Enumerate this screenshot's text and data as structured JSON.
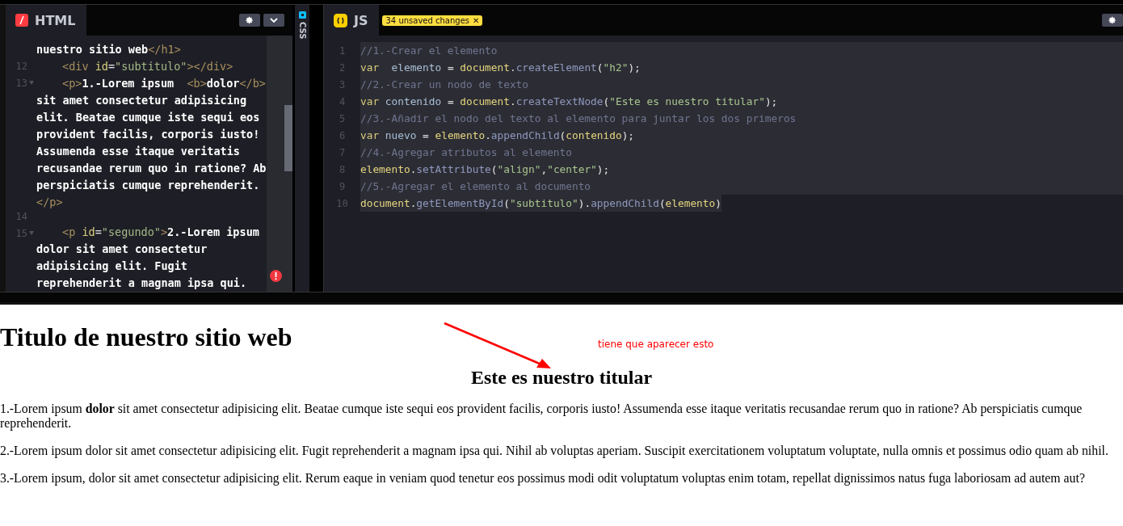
{
  "html_editor": {
    "title": "HTML",
    "lines": [
      {
        "tokens": [
          {
            "kind": "text",
            "text": "nuestro sitio web"
          },
          {
            "kind": "tag",
            "text": "</h1>"
          }
        ]
      },
      {
        "number": "12",
        "fold": false,
        "indented": true,
        "tokens": [
          {
            "kind": "tag",
            "text": "<div "
          },
          {
            "kind": "attr",
            "text": "id"
          },
          {
            "kind": "punct",
            "text": "="
          },
          {
            "kind": "string",
            "text": "\"subtitulo\""
          },
          {
            "kind": "tag",
            "text": "></div>"
          }
        ]
      },
      {
        "number": "13",
        "fold": true,
        "indented": true,
        "tokens": [
          {
            "kind": "tag",
            "text": "<p>"
          },
          {
            "kind": "text",
            "text": "1.-Lorem ipsum  "
          },
          {
            "kind": "tag",
            "text": "<b>"
          },
          {
            "kind": "text",
            "text": "dolor"
          },
          {
            "kind": "tag",
            "text": "</b>"
          }
        ]
      },
      {
        "tokens": [
          {
            "kind": "text",
            "text": "sit amet consectetur adipisicing"
          }
        ]
      },
      {
        "tokens": [
          {
            "kind": "text",
            "text": "elit. Beatae cumque iste sequi eos"
          }
        ]
      },
      {
        "tokens": [
          {
            "kind": "text",
            "text": "provident facilis, corporis iusto!"
          }
        ]
      },
      {
        "tokens": [
          {
            "kind": "text",
            "text": "Assumenda esse itaque veritatis"
          }
        ]
      },
      {
        "tokens": [
          {
            "kind": "text",
            "text": "recusandae rerum quo in ratione? Ab"
          }
        ]
      },
      {
        "tokens": [
          {
            "kind": "text",
            "text": "perspiciatis cumque reprehenderit."
          }
        ]
      },
      {
        "tokens": [
          {
            "kind": "tag",
            "text": "</p>"
          }
        ]
      },
      {
        "number": "14",
        "fold": false
      },
      {
        "number": "15",
        "fold": true,
        "indented": true,
        "tokens": [
          {
            "kind": "tag",
            "text": "<p "
          },
          {
            "kind": "attr",
            "text": "id"
          },
          {
            "kind": "punct",
            "text": "="
          },
          {
            "kind": "string",
            "text": "\"segundo\""
          },
          {
            "kind": "tag",
            "text": ">"
          },
          {
            "kind": "text",
            "text": "2.-Lorem ipsum"
          }
        ]
      },
      {
        "tokens": [
          {
            "kind": "text",
            "text": "dolor sit amet consectetur"
          }
        ]
      },
      {
        "tokens": [
          {
            "kind": "text",
            "text": "adipisicing elit. Fugit"
          }
        ]
      },
      {
        "tokens": [
          {
            "kind": "text",
            "text": "reprehenderit a magnam ipsa qui."
          }
        ]
      }
    ]
  },
  "css_editor": {
    "title": "CSS"
  },
  "js_editor": {
    "title": "JS",
    "badge": "34 unsaved changes",
    "badge_close": "✕",
    "lines": [
      {
        "number": "1",
        "tokens": [
          {
            "kind": "comment",
            "text": "//1.-Crear el elemento"
          }
        ]
      },
      {
        "number": "2",
        "tokens": [
          {
            "kind": "keyword",
            "text": "var  "
          },
          {
            "kind": "ident",
            "text": "elemento"
          },
          {
            "kind": "punct",
            "text": " = "
          },
          {
            "kind": "object",
            "text": "document"
          },
          {
            "kind": "punct",
            "text": "."
          },
          {
            "kind": "method",
            "text": "createElement"
          },
          {
            "kind": "punct",
            "text": "("
          },
          {
            "kind": "string",
            "text": "\"h2\""
          },
          {
            "kind": "punct",
            "text": ");"
          }
        ]
      },
      {
        "number": "3",
        "tokens": [
          {
            "kind": "comment",
            "text": "//2.-Crear un nodo de texto"
          }
        ]
      },
      {
        "number": "4",
        "tokens": [
          {
            "kind": "keyword",
            "text": "var "
          },
          {
            "kind": "ident",
            "text": "contenido"
          },
          {
            "kind": "punct",
            "text": " = "
          },
          {
            "kind": "object",
            "text": "document"
          },
          {
            "kind": "punct",
            "text": "."
          },
          {
            "kind": "method",
            "text": "createTextNode"
          },
          {
            "kind": "punct",
            "text": "("
          },
          {
            "kind": "string",
            "text": "\"Este es nuestro titular\""
          },
          {
            "kind": "punct",
            "text": ");"
          }
        ]
      },
      {
        "number": "5",
        "tokens": [
          {
            "kind": "comment",
            "text": "//3.-Añadir el nodo del texto al elemento para juntar los dos primeros"
          }
        ]
      },
      {
        "number": "6",
        "tokens": [
          {
            "kind": "keyword",
            "text": "var "
          },
          {
            "kind": "ident",
            "text": "nuevo"
          },
          {
            "kind": "punct",
            "text": " = "
          },
          {
            "kind": "object",
            "text": "elemento"
          },
          {
            "kind": "punct",
            "text": "."
          },
          {
            "kind": "method",
            "text": "appendChild"
          },
          {
            "kind": "punct",
            "text": "("
          },
          {
            "kind": "object",
            "text": "contenido"
          },
          {
            "kind": "punct",
            "text": ");"
          }
        ]
      },
      {
        "number": "7",
        "tokens": [
          {
            "kind": "comment",
            "text": "//4.-Agregar atributos al elemento"
          }
        ]
      },
      {
        "number": "8",
        "tokens": [
          {
            "kind": "object",
            "text": "elemento"
          },
          {
            "kind": "punct",
            "text": "."
          },
          {
            "kind": "method",
            "text": "setAttribute"
          },
          {
            "kind": "punct",
            "text": "("
          },
          {
            "kind": "string",
            "text": "\"align\""
          },
          {
            "kind": "punct",
            "text": ","
          },
          {
            "kind": "string",
            "text": "\"center\""
          },
          {
            "kind": "punct",
            "text": ");"
          }
        ]
      },
      {
        "number": "9",
        "tokens": [
          {
            "kind": "comment",
            "text": "//5.-Agregar el elemento al documento"
          }
        ]
      },
      {
        "number": "10",
        "tokens": [
          {
            "kind": "object",
            "text": "document"
          },
          {
            "kind": "punct",
            "text": "."
          },
          {
            "kind": "method",
            "text": "getElementById"
          },
          {
            "kind": "punct",
            "text": "("
          },
          {
            "kind": "string",
            "text": "\"subtitulo\""
          },
          {
            "kind": "punct",
            "text": ")."
          },
          {
            "kind": "method",
            "text": "appendChild"
          },
          {
            "kind": "punct",
            "text": "("
          },
          {
            "kind": "object",
            "text": "elemento"
          },
          {
            "kind": "punct",
            "text": ")"
          }
        ]
      }
    ]
  },
  "preview": {
    "heading": "Titulo de nuestro sitio web",
    "annotation": "tiene que aparecer esto",
    "subheading": "Este es nuestro titular",
    "paragraphs": [
      "1.-Lorem ipsum **dolor** sit amet consectetur adipisicing elit. Beatae cumque iste sequi eos provident facilis, corporis iusto! Assumenda esse itaque veritatis recusandae rerum quo in ratione? Ab perspiciatis cumque reprehenderit.",
      "2.-Lorem ipsum dolor sit amet consectetur adipisicing elit. Fugit reprehenderit a magnam ipsa qui. Nihil ab voluptas aperiam. Suscipit exercitationem voluptatum voluptate, nulla omnis et possimus odio quam ab nihil.",
      "3.-Lorem ipsum, dolor sit amet consectetur adipisicing elit. Rerum eaque in veniam quod tenetur eos possimus modi odit voluptatum voluptas enim totam, repellat dignissimos natus fuga laboriosam ad autem aut?"
    ]
  }
}
